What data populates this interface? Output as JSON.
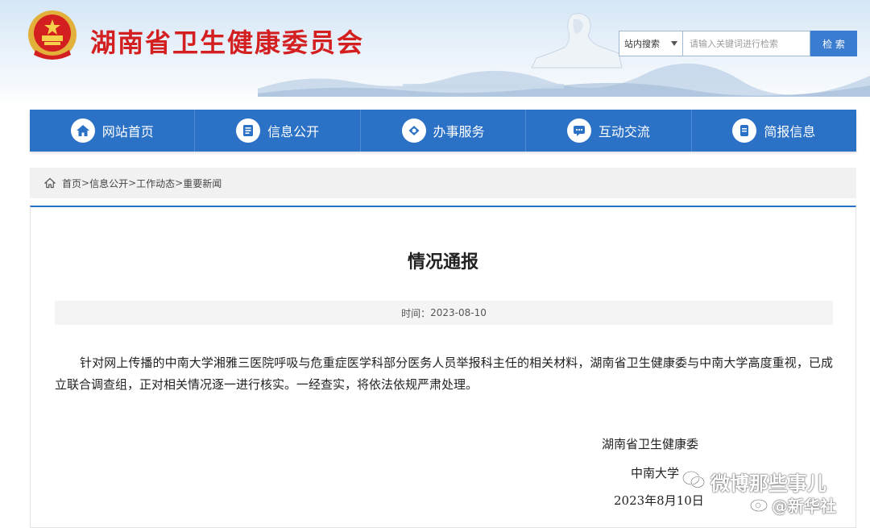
{
  "header": {
    "site_title": "湖南省卫生健康委员会"
  },
  "search": {
    "scope_label": "站内搜索",
    "placeholder": "请输入关键词进行检索",
    "button_label": "检 索"
  },
  "nav": {
    "items": [
      {
        "label": "网站首页",
        "icon": "home-icon"
      },
      {
        "label": "信息公开",
        "icon": "document-icon"
      },
      {
        "label": "办事服务",
        "icon": "service-icon"
      },
      {
        "label": "互动交流",
        "icon": "chat-icon"
      },
      {
        "label": "简报信息",
        "icon": "report-icon"
      }
    ]
  },
  "breadcrumb": {
    "items": [
      "首页",
      "信息公开",
      "工作动态",
      "重要新闻"
    ],
    "separator": ">"
  },
  "article": {
    "title": "情况通报",
    "meta_label": "时间：",
    "date": "2023-08-10",
    "body": "针对网上传播的中南大学湘雅三医院呼吸与危重症医学科部分医务人员举报科主任的相关材料，湖南省卫生健康委与中南大学高度重视，已成立联合调查组，正对相关情况逐一进行核实。一经查实，将依法依规严肃处理。",
    "signature": {
      "org1": "湖南省卫生健康委",
      "org2": "中南大学",
      "date": "2023年8月10日"
    }
  },
  "watermarks": {
    "weibo": "微博那些事儿",
    "xinhua": "@新华社"
  },
  "colors": {
    "brand_red": "#d41f20",
    "nav_blue": "#2b71c5",
    "search_blue": "#3a7cd0"
  }
}
